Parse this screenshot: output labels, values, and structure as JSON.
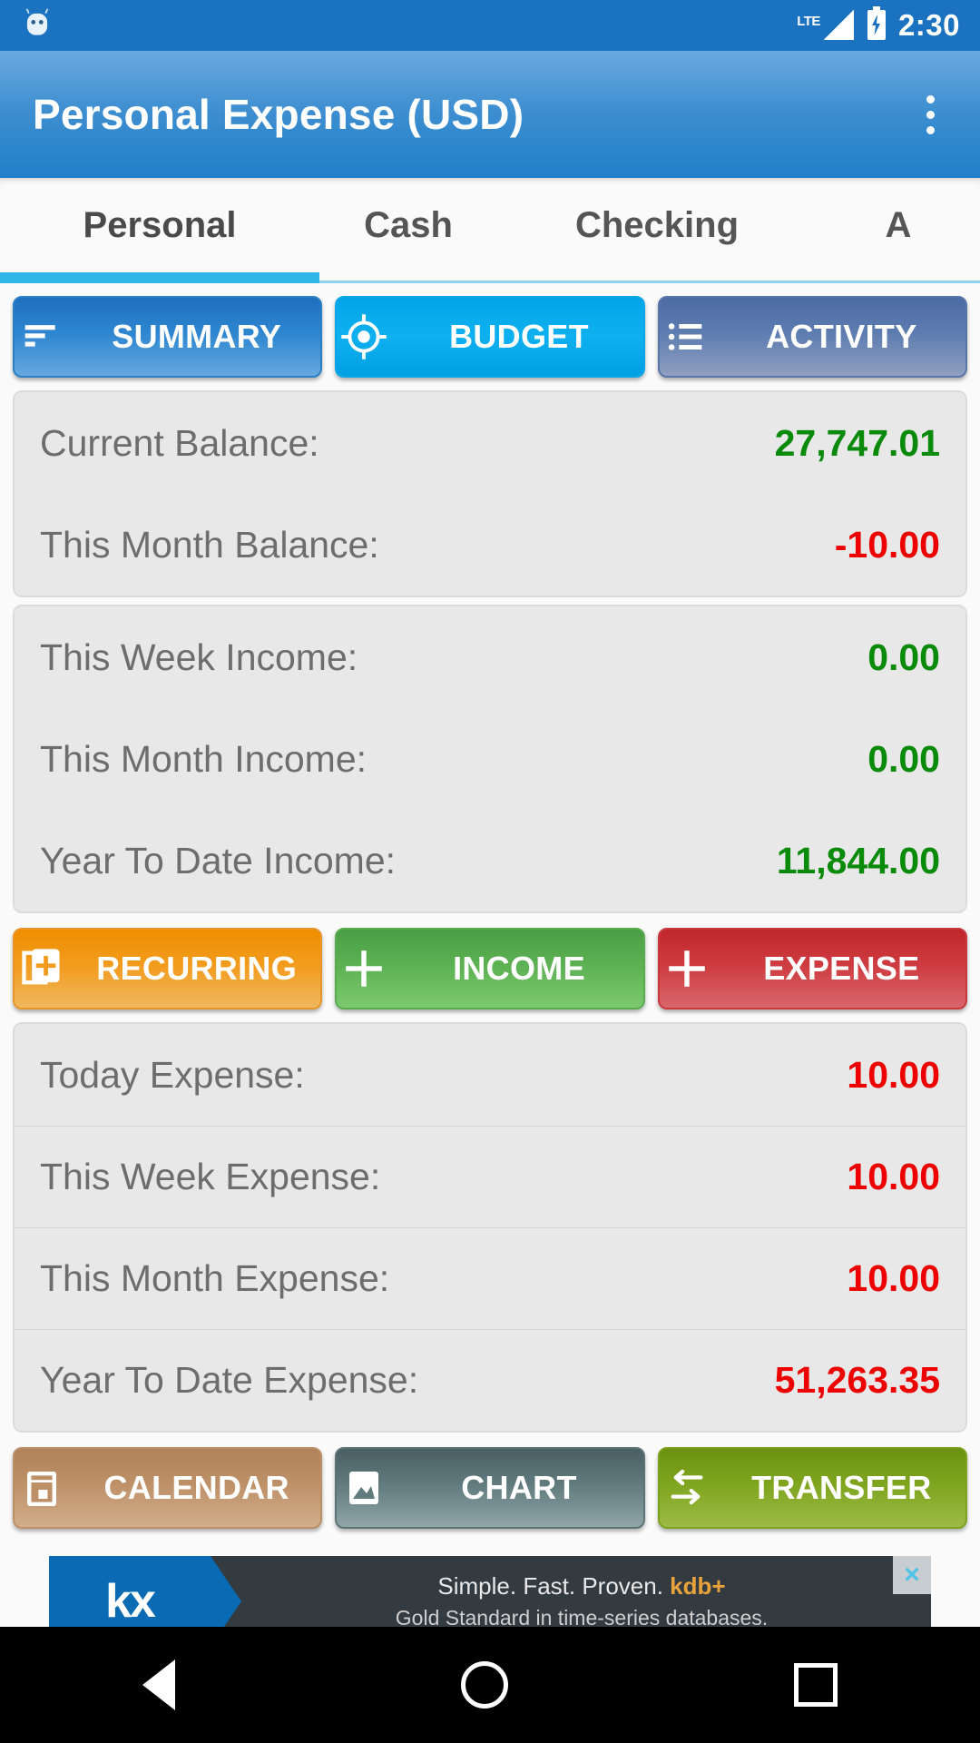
{
  "status_bar": {
    "app_icon": "android-robot-icon",
    "network": "LTE",
    "signal_icon": "signal-bars-icon",
    "battery_icon": "battery-charging-icon",
    "time": "2:30"
  },
  "app_bar": {
    "title": "Personal Expense (USD)",
    "overflow_icon": "overflow-menu-icon"
  },
  "tabs": {
    "items": [
      {
        "label": "Personal",
        "active": true
      },
      {
        "label": "Cash",
        "active": false
      },
      {
        "label": "Checking",
        "active": false
      },
      {
        "label": "A",
        "active": false
      }
    ],
    "active_underline_color": "#2fb5e8"
  },
  "mode_buttons": [
    {
      "label": "SUMMARY",
      "icon": "bar-list-icon",
      "color": "#2e86d0",
      "selected": false
    },
    {
      "label": "BUDGET",
      "icon": "target-icon",
      "color": "#0fb0ef",
      "selected": true
    },
    {
      "label": "ACTIVITY",
      "icon": "list-bullet-icon",
      "color": "#5d7cb0",
      "selected": false
    }
  ],
  "balance_card": {
    "rows": [
      {
        "label": "Current Balance:",
        "value": "27,747.01",
        "tone": "pos"
      },
      {
        "label": "This Month Balance:",
        "value": "-10.00",
        "tone": "neg"
      }
    ]
  },
  "income_card": {
    "rows": [
      {
        "label": "This Week Income:",
        "value": "0.00",
        "tone": "pos"
      },
      {
        "label": "This Month Income:",
        "value": "0.00",
        "tone": "pos"
      },
      {
        "label": "Year To Date Income:",
        "value": "11,844.00",
        "tone": "pos"
      }
    ]
  },
  "action_buttons": [
    {
      "label": "RECURRING",
      "icon": "card-plus-icon",
      "color": "#f29b1d"
    },
    {
      "label": "INCOME",
      "icon": "plus-icon",
      "color": "#5cb152"
    },
    {
      "label": "EXPENSE",
      "icon": "plus-icon",
      "color": "#ce3b40"
    }
  ],
  "expense_card": {
    "rows": [
      {
        "label": "Today Expense:",
        "value": "10.00",
        "tone": "neg"
      },
      {
        "label": "This Week Expense:",
        "value": "10.00",
        "tone": "neg"
      },
      {
        "label": "This Month Expense:",
        "value": "10.00",
        "tone": "neg"
      },
      {
        "label": "Year To Date Expense:",
        "value": "51,263.35",
        "tone": "neg"
      }
    ]
  },
  "tool_buttons": [
    {
      "label": "CALENDAR",
      "icon": "calendar-icon",
      "color": "#bd9068"
    },
    {
      "label": "CHART",
      "icon": "image-chart-icon",
      "color": "#607a7d"
    },
    {
      "label": "TRANSFER",
      "icon": "transfer-arrows-icon",
      "color": "#7fa51f"
    }
  ],
  "ad": {
    "logo_text": "kx",
    "line1_prefix": "Simple. Fast. Proven. ",
    "line1_brand": "kdb+",
    "line2": "Gold Standard in time-series databases.",
    "close_label": "×"
  },
  "nav_bar": {
    "back_icon": "back-triangle-icon",
    "home_icon": "home-circle-icon",
    "recents_icon": "recents-square-icon"
  },
  "colors": {
    "positive": "#0a8a0a",
    "negative": "#ee0000",
    "app_bar": "#2080c8",
    "status_bar": "#1b72c0"
  }
}
